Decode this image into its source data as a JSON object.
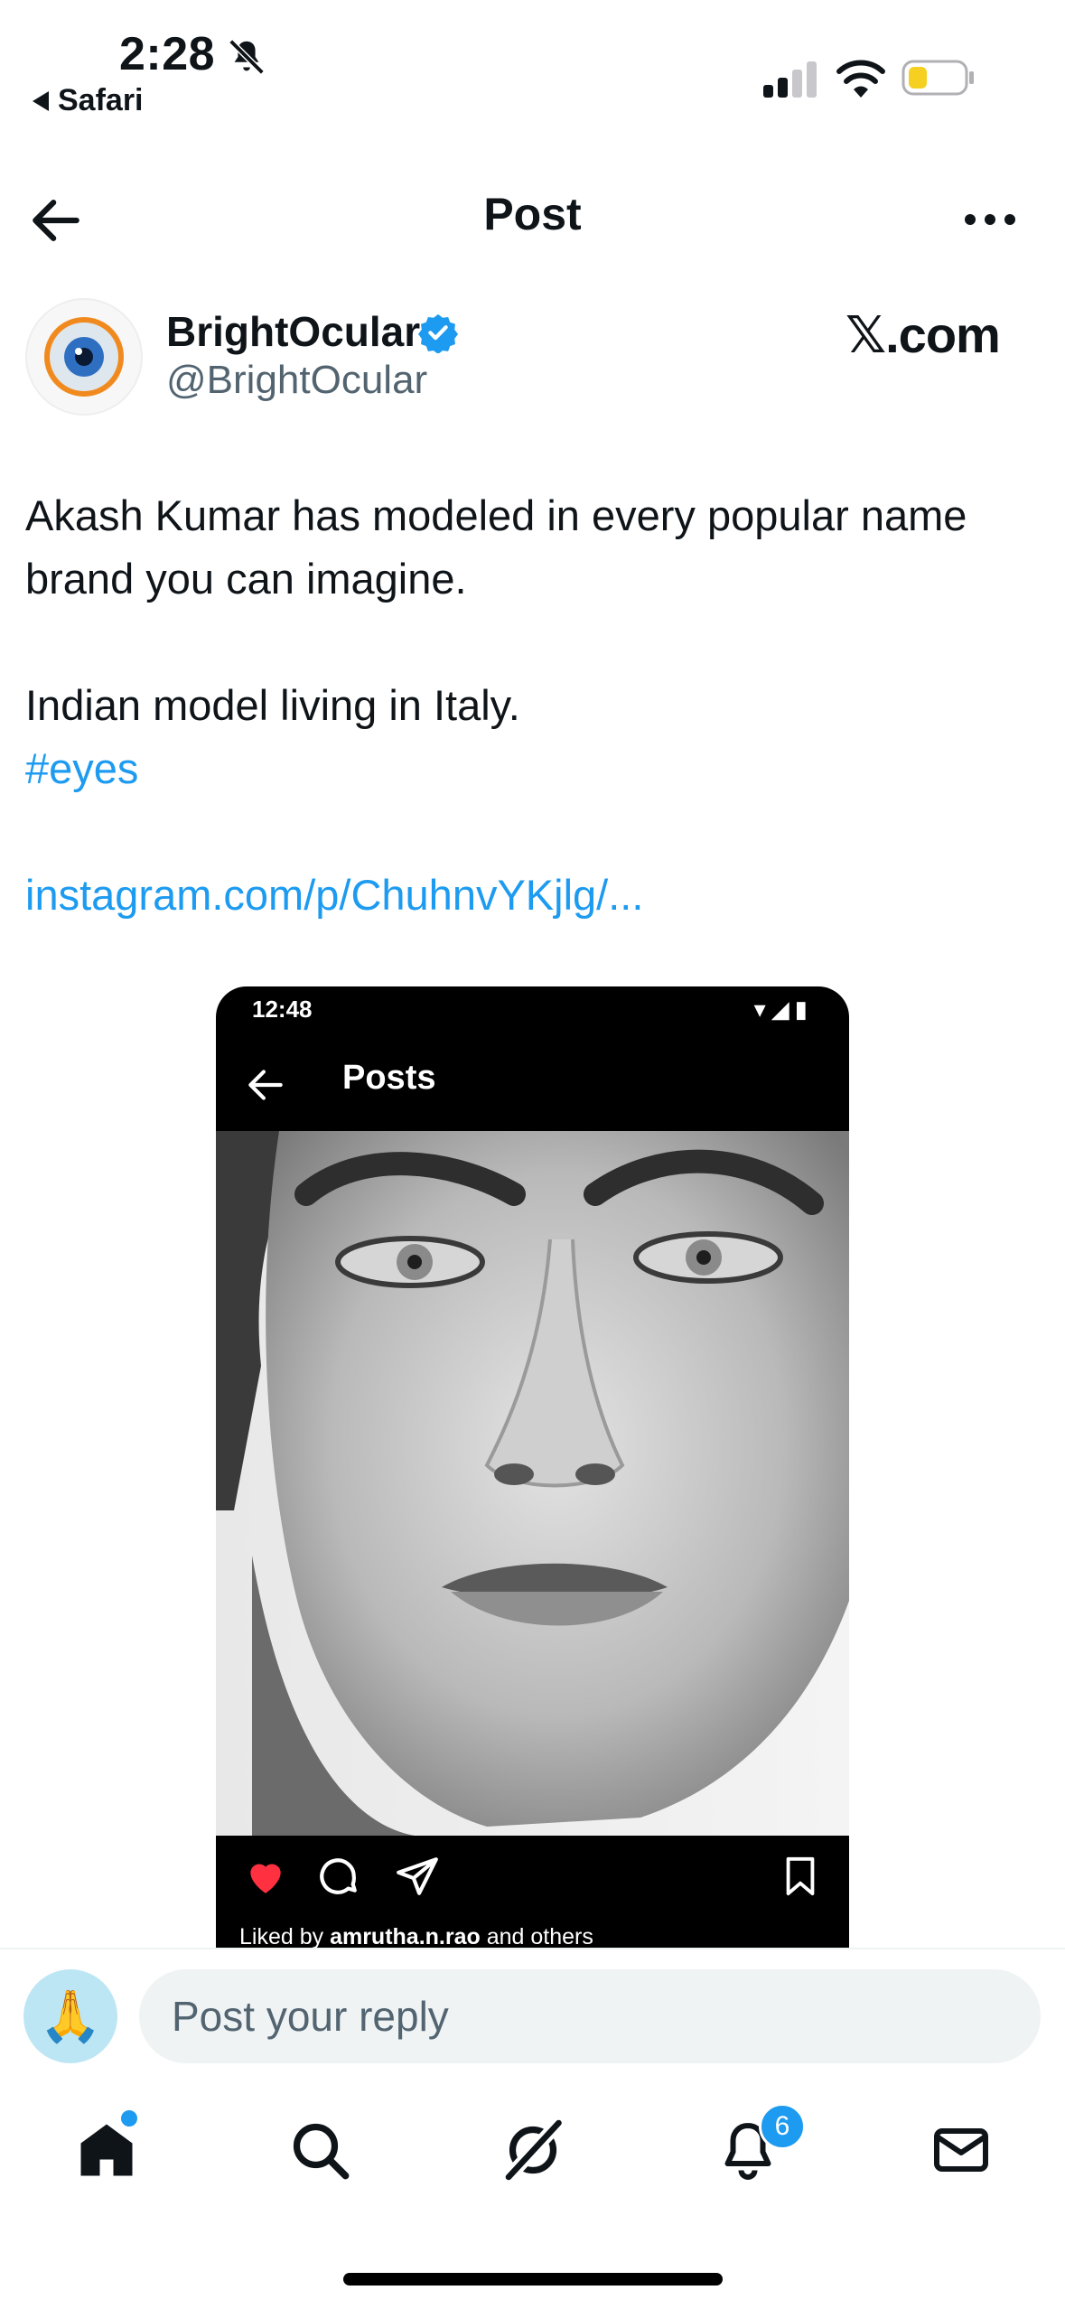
{
  "status_bar": {
    "time": "2:28",
    "back_app": "Safari"
  },
  "header": {
    "title": "Post"
  },
  "author": {
    "name": "BrightOcular",
    "handle": "@BrightOcular",
    "source": "𝕏.com"
  },
  "tweet": {
    "line1": "Akash Kumar has modeled in every popular name",
    "line2": "brand you can imagine.",
    "line3": "Indian model living in Italy.",
    "hashtag": "#eyes",
    "link": "instagram.com/p/ChuhnvYKjlg/..."
  },
  "media": {
    "time": "12:48",
    "title": "Posts",
    "liked_by_prefix": "Liked by ",
    "liked_by_user": "amrutha.n.rao",
    "liked_by_suffix": " and others"
  },
  "reply": {
    "placeholder": "Post your reply",
    "avatar_emoji": "🙏"
  },
  "nav": {
    "notifications_badge": "6",
    "active": "home"
  },
  "colors": {
    "accent": "#1d9bf0",
    "text": "#0f1419",
    "muted": "#536471"
  }
}
